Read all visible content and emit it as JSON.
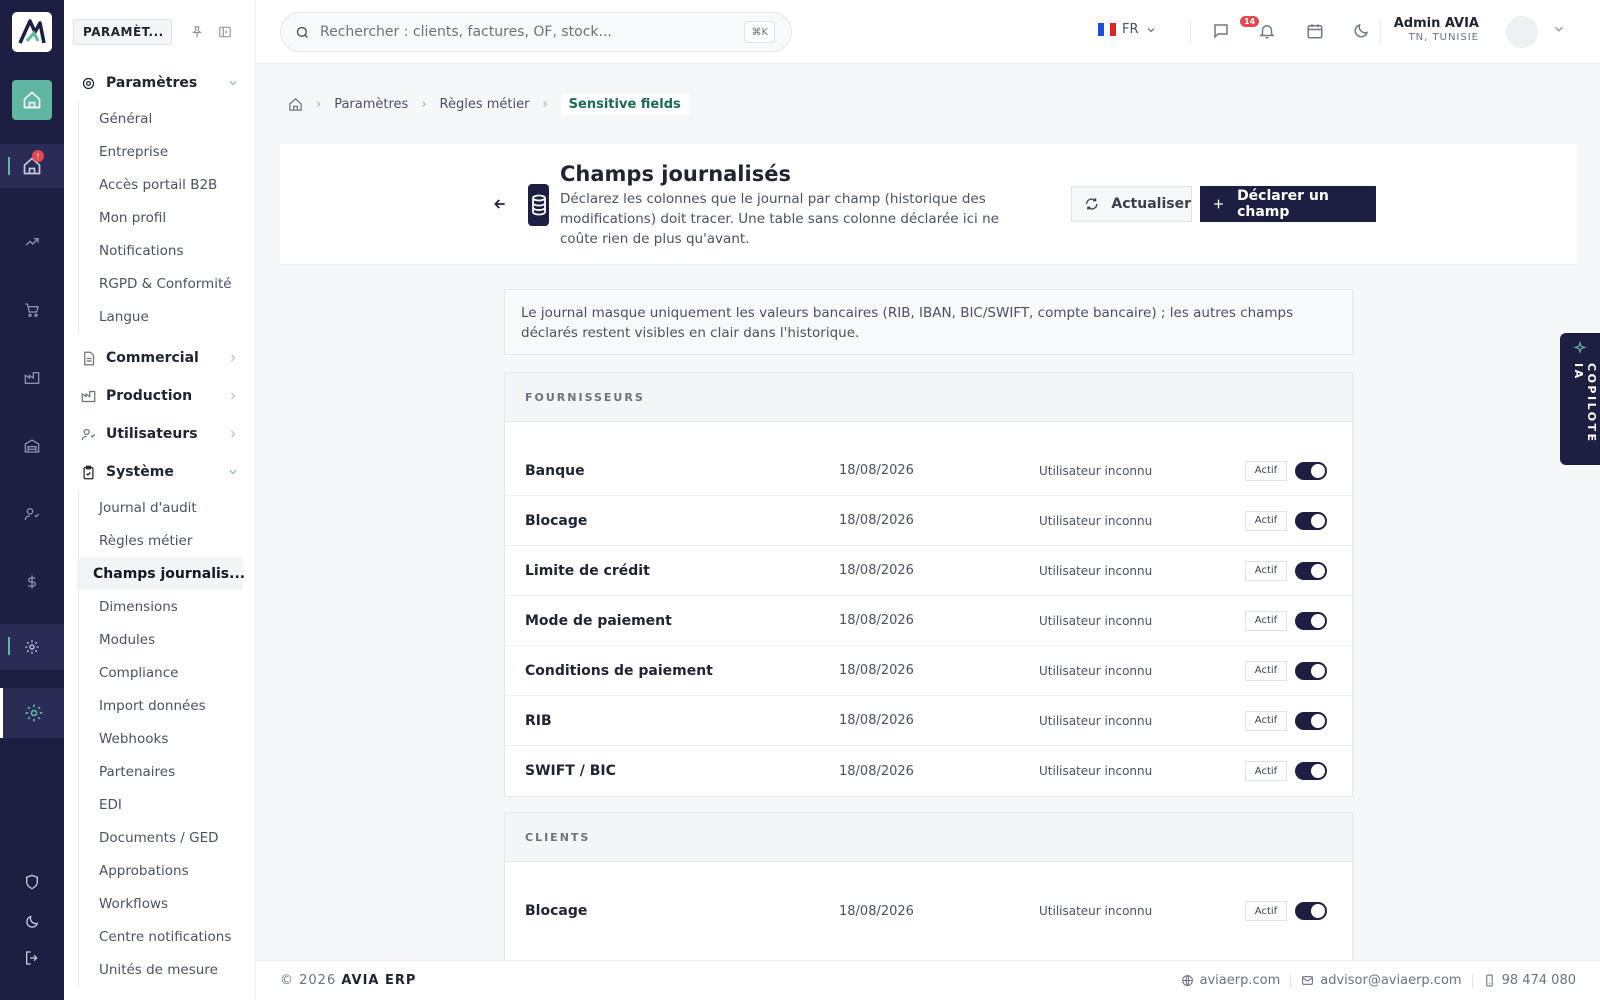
{
  "sidebar": {
    "section_tag": "PARAMÈT...",
    "groups": [
      {
        "label": "Paramètres"
      },
      {
        "label": "Commercial"
      },
      {
        "label": "Production"
      },
      {
        "label": "Utilisateurs"
      },
      {
        "label": "Système"
      }
    ],
    "params_items": [
      "Général",
      "Entreprise",
      "Accès portail B2B",
      "Mon profil",
      "Notifications",
      "RGPD & Conformité",
      "Langue"
    ],
    "system_items": [
      "Journal d'audit",
      "Règles métier",
      "Champs journalis...",
      "Dimensions",
      "Modules",
      "Compliance",
      "Import données",
      "Webhooks",
      "Partenaires",
      "EDI",
      "Documents / GED",
      "Approbations",
      "Workflows",
      "Centre notifications",
      "Unités de mesure"
    ],
    "rail_badge": "!"
  },
  "topbar": {
    "search_placeholder": "Rechercher : clients, factures, OF, stock...",
    "shortcut": "⌘K",
    "lang": "FR",
    "notif_count": "14",
    "user_name": "Admin AVIA",
    "user_location": "TN, TUNISIE"
  },
  "breadcrumb": [
    "Paramètres",
    "Règles métier",
    "Sensitive fields"
  ],
  "header": {
    "title": "Champs journalisés",
    "description": "Déclarez les colonnes que le journal par champ (historique des modifications) doit tracer. Une table sans colonne déclarée ici ne coûte rien de plus qu'avant.",
    "refresh_label": "Actualiser",
    "declare_label": "Déclarer un champ"
  },
  "info_text": "Le journal masque uniquement les valeurs bancaires (RIB, IBAN, BIC/SWIFT, compte bancaire) ; les autres champs déclarés restent visibles en clair dans l'historique.",
  "sections": [
    {
      "title": "FOURNISSEURS",
      "rows": [
        {
          "name": "Banque",
          "date": "18/08/2026",
          "user": "Utilisateur inconnu",
          "status": "Actif",
          "enabled": true
        },
        {
          "name": "Blocage",
          "date": "18/08/2026",
          "user": "Utilisateur inconnu",
          "status": "Actif",
          "enabled": true
        },
        {
          "name": "Limite de crédit",
          "date": "18/08/2026",
          "user": "Utilisateur inconnu",
          "status": "Actif",
          "enabled": true
        },
        {
          "name": "Mode de paiement",
          "date": "18/08/2026",
          "user": "Utilisateur inconnu",
          "status": "Actif",
          "enabled": true
        },
        {
          "name": "Conditions de paiement",
          "date": "18/08/2026",
          "user": "Utilisateur inconnu",
          "status": "Actif",
          "enabled": true
        },
        {
          "name": "RIB",
          "date": "18/08/2026",
          "user": "Utilisateur inconnu",
          "status": "Actif",
          "enabled": true
        },
        {
          "name": "SWIFT / BIC",
          "date": "18/08/2026",
          "user": "Utilisateur inconnu",
          "status": "Actif",
          "enabled": true
        }
      ]
    },
    {
      "title": "CLIENTS",
      "rows": [
        {
          "name": "Blocage",
          "date": "18/08/2026",
          "user": "Utilisateur inconnu",
          "status": "Actif",
          "enabled": true
        }
      ]
    }
  ],
  "copilot_label": "COPILOTE IA",
  "footer": {
    "copyright": "© 2026",
    "brand": "AVIA ERP",
    "website": "aviaerp.com",
    "email": "advisor@aviaerp.com",
    "phone": "98 474 080"
  },
  "colors": {
    "primary": "#1d1f42",
    "accent": "#5fb6a1",
    "breadcrumb_active": "#1a6b53",
    "badge": "#e5484d"
  }
}
